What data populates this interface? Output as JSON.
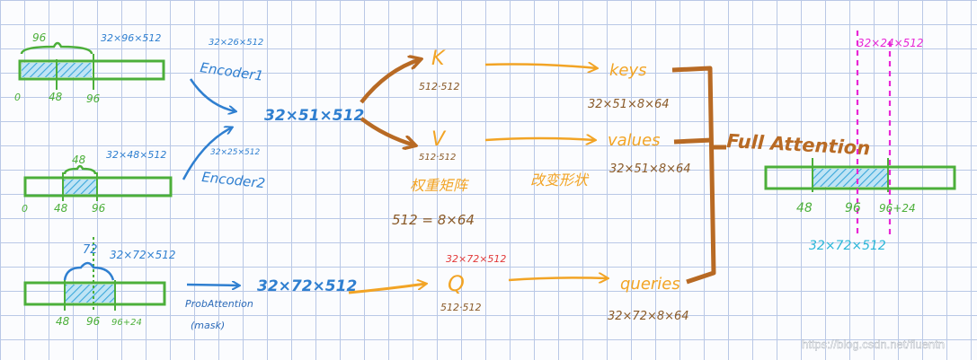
{
  "colors": {
    "green": "#4caf3a",
    "blue": "#2f7fd0",
    "navy": "#2b6ab8",
    "orange": "#f2a425",
    "brown": "#b86a24",
    "magenta": "#e826d6",
    "cyan": "#29b6d8",
    "hatch": "#3aa7da",
    "red": "#e23a3a"
  },
  "inputs": {
    "enc1": {
      "label_top": "96",
      "shape": "32×96×512",
      "tick0": "0",
      "tick1": "48",
      "tick2": "96"
    },
    "enc2": {
      "label_top": "48",
      "shape": "32×48×512",
      "tick0": "0",
      "tick1": "48",
      "tick2": "96"
    },
    "dec": {
      "label_top": "72",
      "shape": "32×72×512",
      "tick1": "48",
      "tick2": "96",
      "tick3": "96+24"
    }
  },
  "encoders": {
    "enc1_label": "Encoder1",
    "enc1_shape": "32×26×512",
    "enc2_label": "Encoder2",
    "enc2_shape": "32×25×512",
    "merged_shape": "32×51×512"
  },
  "decoder": {
    "label": "ProbAttention",
    "sublabel": "(mask)",
    "shape": "32×72×512"
  },
  "projections": {
    "k": {
      "symbol": "K",
      "dims": "512·512"
    },
    "v": {
      "symbol": "V",
      "dims": "512·512"
    },
    "q": {
      "symbol": "Q",
      "dims": "512·512",
      "shape_note": "32×72×512"
    },
    "weight_label": "权重矩阵",
    "weight_eq": "512 = 8×64",
    "reshape_label": "改变形状"
  },
  "outputs": {
    "keys": "keys",
    "keys_shape": "32×51×8×64",
    "values": "values",
    "values_shape": "32×51×8×64",
    "queries": "queries",
    "queries_shape": "32×72×8×64"
  },
  "attention": {
    "label": "Full Attention",
    "pred_shape": "32×24×512",
    "tick1": "48",
    "tick2": "96",
    "tick3": "96+24",
    "out_shape": "32×72×512"
  },
  "watermark": "https://blog.csdn.net/fluentn"
}
